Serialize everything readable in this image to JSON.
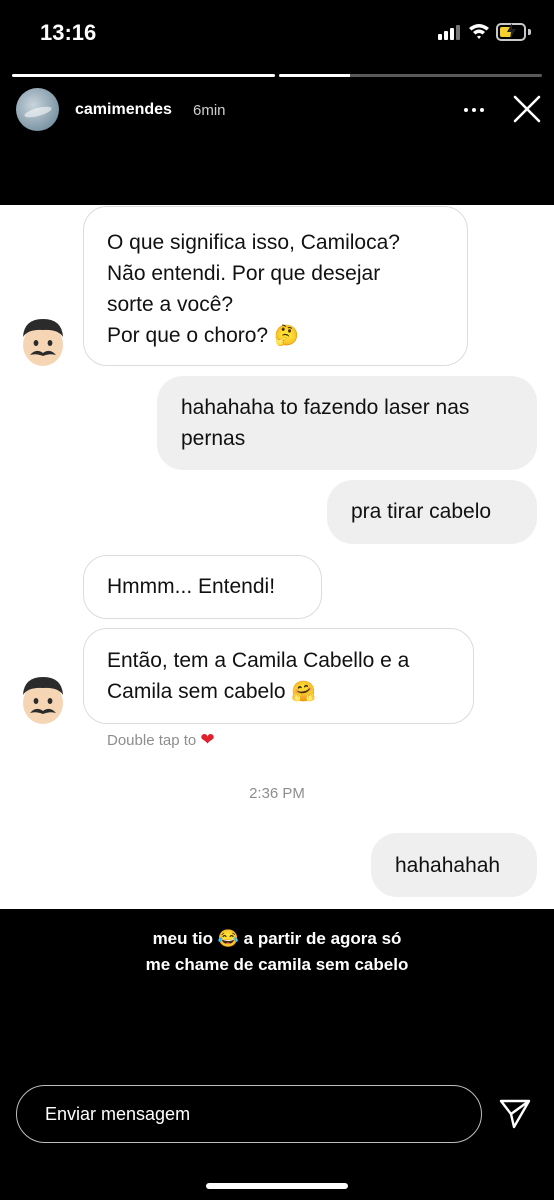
{
  "status_bar": {
    "time": "13:16",
    "battery_level": 0.55
  },
  "story": {
    "username": "camimendes",
    "time_ago": "6min",
    "progress": [
      1.0,
      0.27
    ]
  },
  "chat": {
    "messages": [
      {
        "side": "in",
        "lines": [
          "O que significa isso, Camiloca?",
          "Não entendi. Por que desejar",
          "sorte a você?",
          "Por que o choro?"
        ],
        "emoji": "🤔"
      },
      {
        "side": "out",
        "lines": [
          "hahahaha to fazendo laser nas",
          "pernas"
        ]
      },
      {
        "side": "out",
        "lines": [
          "pra tirar cabelo"
        ]
      },
      {
        "side": "in",
        "lines": [
          "Hmmm... Entendi!"
        ]
      },
      {
        "side": "in",
        "lines": [
          "Então, tem a Camila Cabello e a",
          "Camila sem cabelo"
        ],
        "emoji": "🤗"
      },
      {
        "side": "out",
        "lines": [
          "hahahahah"
        ]
      }
    ],
    "double_tap_hint": "Double tap to",
    "heart_glyph": "❤",
    "timestamp": "2:36 PM"
  },
  "caption": {
    "line1": "meu tio",
    "line1_emoji": "😂",
    "line1_rest": "a partir de agora só",
    "line2": "me chame de camila sem cabelo"
  },
  "reply": {
    "placeholder": "Enviar mensagem"
  },
  "icons": {
    "avatar": "profile-photo",
    "more": "more-dots-icon",
    "close": "close-icon",
    "face": "man-emoji-icon",
    "send": "paper-plane-icon"
  }
}
